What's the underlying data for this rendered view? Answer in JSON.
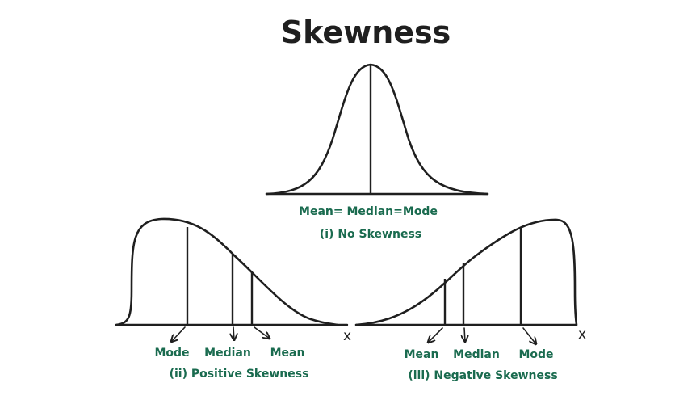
{
  "title": "Skewness",
  "panels": {
    "no_skew": {
      "label": "Mean=  Median=Mode",
      "caption": "(i) No Skewness"
    },
    "positive": {
      "mode": "Mode",
      "median": "Median",
      "mean": "Mean",
      "x": "x",
      "caption": "(ii) Positive Skewness"
    },
    "negative": {
      "mean": "Mean",
      "median": "Median",
      "mode": "Mode",
      "x": "x",
      "caption": "(iii) Negative Skewness"
    }
  },
  "colors": {
    "label": "#1a6b4f",
    "ink": "#1f1f1f"
  }
}
